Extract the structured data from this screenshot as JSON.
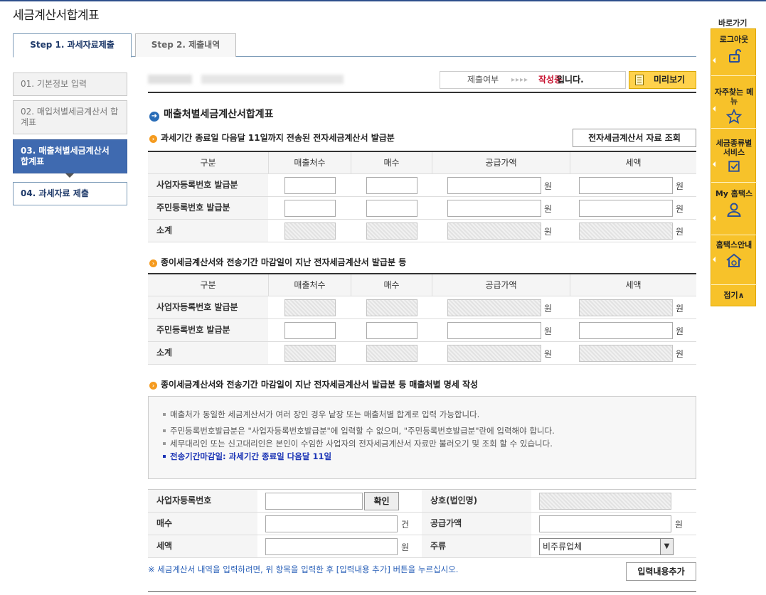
{
  "page": {
    "title": "세금계산서합계표"
  },
  "tabs": [
    {
      "label": "Step 1. 과세자료제출",
      "active": true
    },
    {
      "label": "Step 2. 제출내역",
      "active": false
    }
  ],
  "steps": [
    {
      "label": "01. 기본정보 입력"
    },
    {
      "label": "02. 매입처별세금계산서 합계표"
    },
    {
      "label": "03. 매출처별세금계산서 합계표"
    },
    {
      "label": "04. 과세자료 제출"
    }
  ],
  "status": {
    "label": "제출여부",
    "arrows": "▸▸▸▸",
    "value": "작성중",
    "suffix": "입니다.",
    "preview_label": "미리보기"
  },
  "section": {
    "title": "매출처별세금계산서합계표"
  },
  "section1": {
    "title": "과세기간 종료일 다음달 11일까지 전송된 전자세금계산서 발급분",
    "lookup_button": "전자세금계산서 자료 조회",
    "headers": [
      "구분",
      "매출처수",
      "매수",
      "공급가액",
      "세액"
    ],
    "rows": [
      {
        "label": "사업자등록번호 발급분",
        "disabled": false
      },
      {
        "label": "주민등록번호 발급분",
        "disabled": false
      },
      {
        "label": "소계",
        "disabled": true
      }
    ],
    "unit": "원"
  },
  "section2": {
    "title": "종이세금계산서와 전송기간 마감일이 지난 전자세금계산서 발급분 등",
    "headers": [
      "구분",
      "매출처수",
      "매수",
      "공급가액",
      "세액"
    ],
    "rows": [
      {
        "label": "사업자등록번호 발급분",
        "disabled": true
      },
      {
        "label": "주민등록번호 발급분",
        "disabled": false
      },
      {
        "label": "소계",
        "disabled": true
      }
    ],
    "unit": "원"
  },
  "section3": {
    "title": "종이세금계산서와 전송기간 마감일이 지난 전자세금계산서 발급분 등 매출처별 명세 작성",
    "info": [
      "매출처가 동일한 세금계산서가 여러 장인 경우 낱장 또는 매출처별 합계로 입력 가능합니다.",
      "주민등록번호발급분은 \"사업자등록번호발급분\"에 입력할 수 없으며, \"주민등록번호발급분\"란에 입력해야 합니다.",
      "세무대리인 또는 신고대리인은 본인이 수임한 사업자의 전자세금계산서 자료만 불러오기 및 조회 할 수 있습니다.",
      "전송기간마감일: 과세기간 종료일 다음달 11일"
    ]
  },
  "form": {
    "biz_no_label": "사업자등록번호",
    "confirm_button": "확인",
    "company_label": "상호(법인명)",
    "count_label": "매수",
    "count_unit": "건",
    "supply_label": "공급가액",
    "supply_unit": "원",
    "tax_label": "세액",
    "tax_unit": "원",
    "type_label": "주류",
    "type_selected": "비주류업체"
  },
  "note": "※ 세금계산서 내역을 입력하려면, 위 항목을 입력한 후 [입력내용 추가] 버튼을 누르십시오.",
  "add_button": "입력내용추가",
  "quick_menu": {
    "title": "바로가기",
    "items": [
      {
        "label": "로그아웃",
        "icon": "lock-open-icon"
      },
      {
        "label": "자주찾는 메뉴",
        "icon": "star-icon"
      },
      {
        "label": "세금종류별 서비스",
        "icon": "checkbox-icon"
      },
      {
        "label": "My 홈택스",
        "icon": "person-icon"
      },
      {
        "label": "홈택스안내",
        "icon": "home-info-icon"
      }
    ],
    "fold_label": "접기∧"
  }
}
